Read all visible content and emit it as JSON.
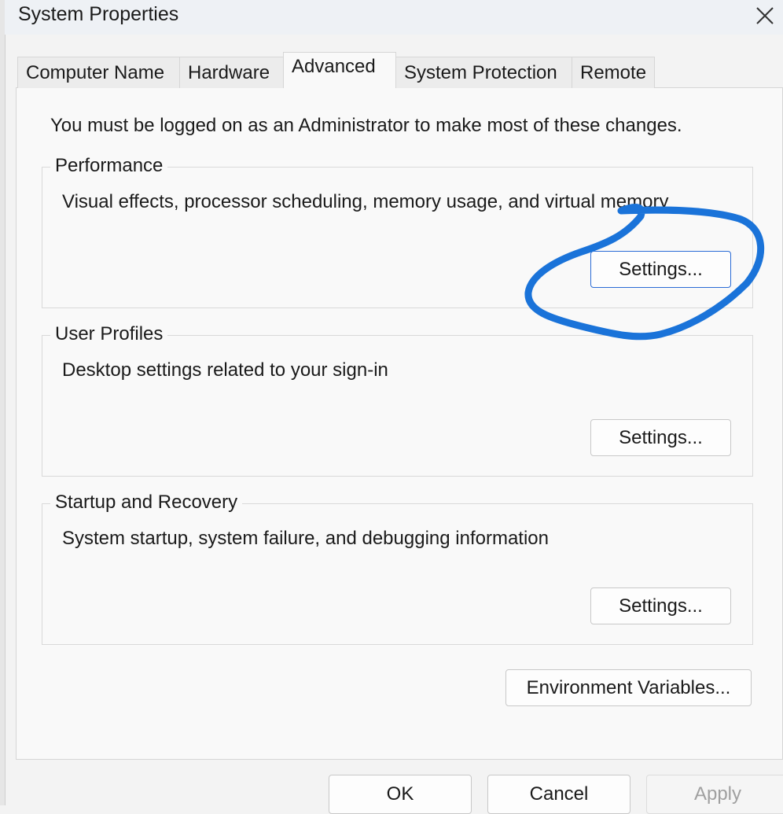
{
  "window": {
    "title": "System Properties"
  },
  "tabs": [
    {
      "label": "Computer Name",
      "active": false
    },
    {
      "label": "Hardware",
      "active": false
    },
    {
      "label": "Advanced",
      "active": true
    },
    {
      "label": "System Protection",
      "active": false
    },
    {
      "label": "Remote",
      "active": false
    }
  ],
  "advanced": {
    "admin_note": "You must be logged on as an Administrator to make most of these changes.",
    "performance": {
      "title": "Performance",
      "description": "Visual effects, processor scheduling, memory usage, and virtual memory",
      "settings_label": "Settings..."
    },
    "user_profiles": {
      "title": "User Profiles",
      "description": "Desktop settings related to your sign-in",
      "settings_label": "Settings..."
    },
    "startup_recovery": {
      "title": "Startup and Recovery",
      "description": "System startup, system failure, and debugging information",
      "settings_label": "Settings..."
    },
    "env_vars_label": "Environment Variables..."
  },
  "footer": {
    "ok_label": "OK",
    "cancel_label": "Cancel",
    "apply_label": "Apply"
  },
  "icons": {
    "close": "close-icon"
  },
  "colors": {
    "annotation": "#1a73d9",
    "focus_border": "#2b6cd6"
  }
}
